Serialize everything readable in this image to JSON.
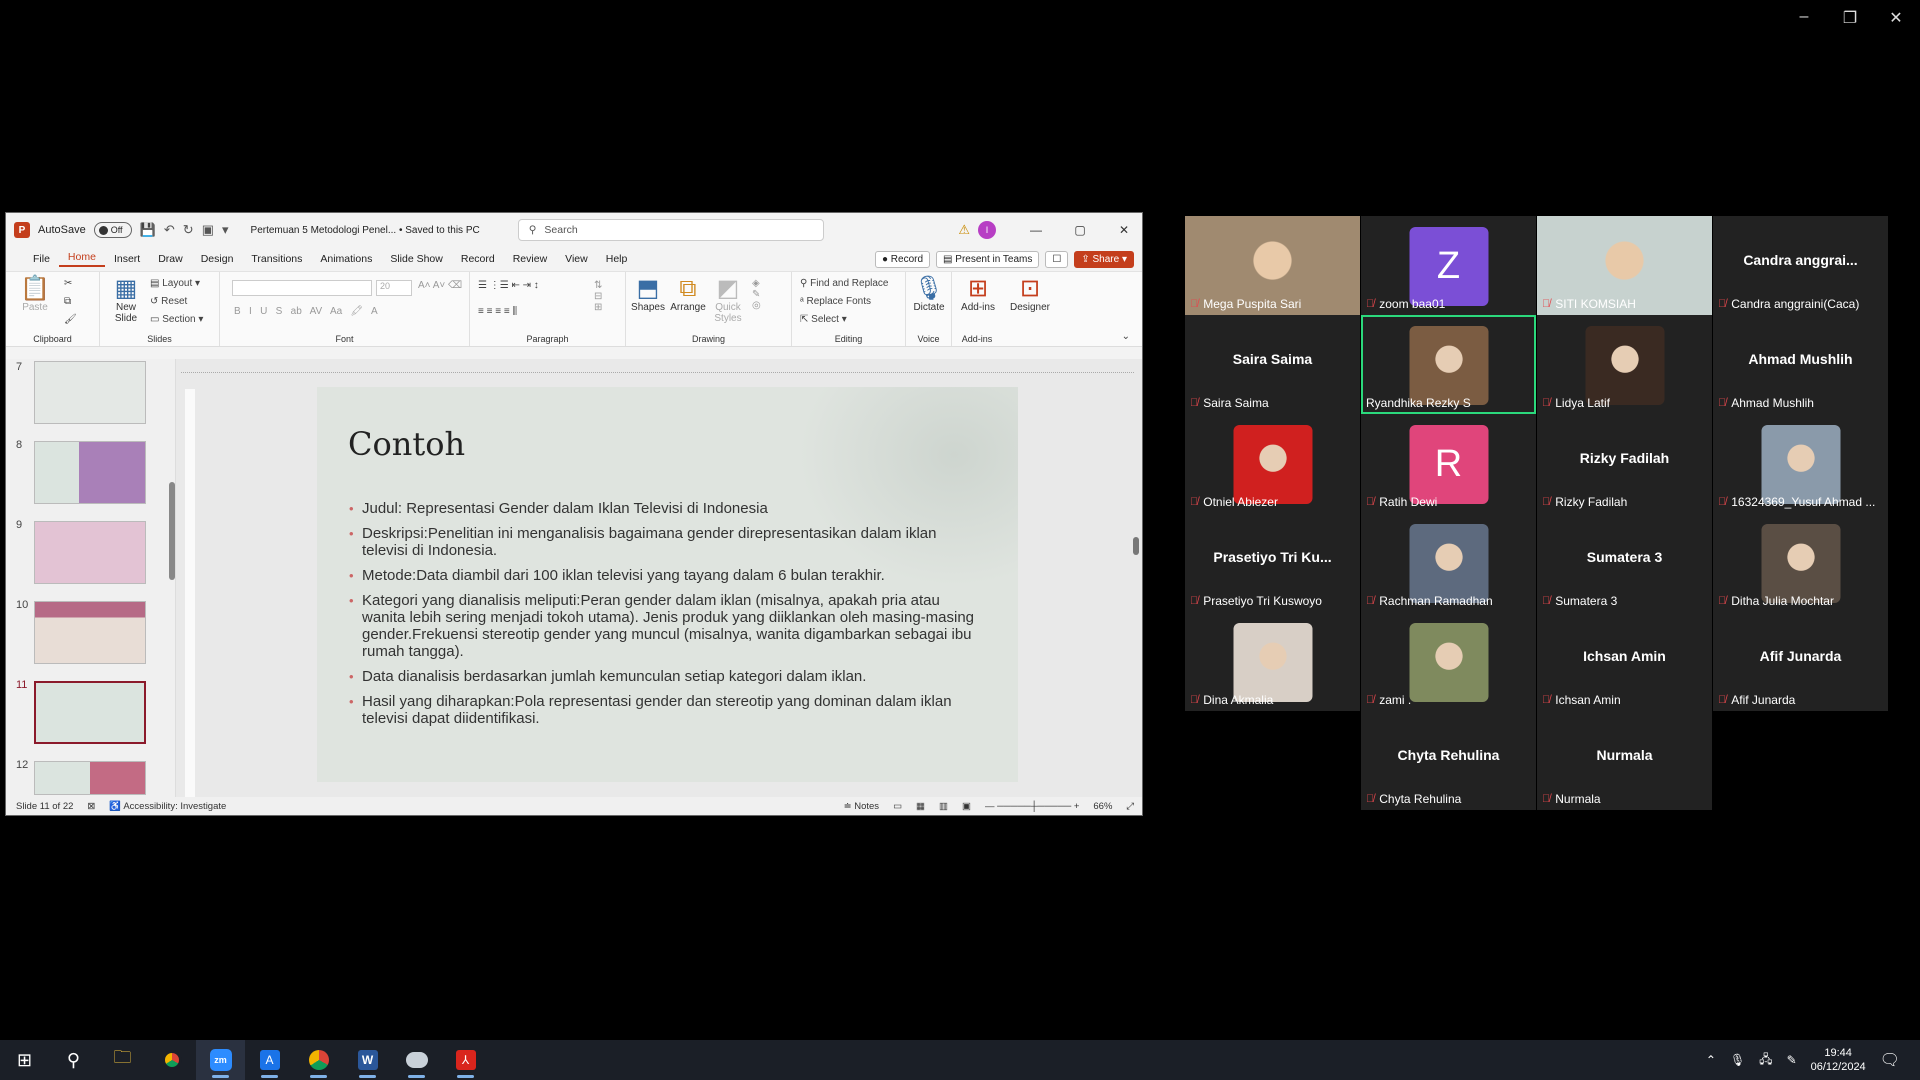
{
  "window_controls": {
    "minimize": "–",
    "restore": "❐",
    "close": "✕"
  },
  "ppt": {
    "autosave_label": "AutoSave",
    "autosave_state": "Off",
    "document_title": "Pertemuan 5 Metodologi Penel... • Saved to this PC",
    "search_placeholder": "Search",
    "user_initial": "I",
    "menu": [
      "File",
      "Home",
      "Insert",
      "Draw",
      "Design",
      "Transitions",
      "Animations",
      "Slide Show",
      "Record",
      "Review",
      "View",
      "Help"
    ],
    "record_button": "Record",
    "present_button": "Present in Teams",
    "share_button": "Share",
    "ribbon": {
      "clipboard": {
        "label": "Clipboard",
        "paste": "Paste"
      },
      "slides": {
        "label": "Slides",
        "new_slide": "New Slide",
        "layout": "Layout",
        "reset": "Reset",
        "section": "Section"
      },
      "font": {
        "label": "Font",
        "size": "20"
      },
      "paragraph": {
        "label": "Paragraph"
      },
      "drawing": {
        "label": "Drawing",
        "shapes": "Shapes",
        "arrange": "Arrange",
        "quick_styles": "Quick Styles"
      },
      "editing": {
        "label": "Editing",
        "find_replace": "Find and Replace",
        "replace_fonts": "Replace Fonts",
        "select": "Select"
      },
      "voice": {
        "label": "Voice",
        "dictate": "Dictate"
      },
      "addins": {
        "label": "Add-ins",
        "addins": "Add-ins",
        "designer": "Designer"
      }
    },
    "thumb_numbers": [
      "7",
      "8",
      "9",
      "10",
      "11",
      "12"
    ],
    "slide": {
      "title": "Contoh",
      "bullets": [
        "Judul: Representasi Gender dalam Iklan Televisi di Indonesia",
        "Deskripsi:Penelitian ini menganalisis bagaimana gender direpresentasikan dalam iklan televisi di Indonesia.",
        "Metode:Data diambil dari 100 iklan televisi yang tayang dalam 6 bulan terakhir.",
        "Kategori yang dianalisis meliputi:Peran gender dalam iklan (misalnya, apakah pria atau wanita lebih sering menjadi tokoh utama). Jenis produk yang diiklankan oleh masing-masing gender.Frekuensi stereotip gender yang muncul (misalnya, wanita digambarkan sebagai ibu rumah tangga).",
        "Data dianalisis berdasarkan jumlah kemunculan setiap kategori dalam iklan.",
        "Hasil yang diharapkan:Pola representasi gender dan stereotip yang dominan dalam iklan televisi dapat diidentifikasi."
      ]
    },
    "status": {
      "slide_count": "Slide 11 of 22",
      "accessibility": "Accessibility: Investigate",
      "notes": "Notes",
      "zoom": "66%"
    }
  },
  "participants": [
    {
      "label": "Mega Puspita Sari",
      "type": "photo",
      "color": "#a08a70"
    },
    {
      "label": "zoom baa01",
      "type": "letter",
      "letter": "Z",
      "color": "#7b4fd6"
    },
    {
      "label": "SITI KOMSIAH",
      "type": "photo",
      "color": "#c7d2cf"
    },
    {
      "label": "Candra anggraini(Caca)",
      "type": "name",
      "name": "Candra  anggrai..."
    },
    {
      "label": "Saira Saima",
      "type": "name",
      "name": "Saira Saima"
    },
    {
      "label": "Ryandhika Rezky S",
      "type": "avatar",
      "color": "#7b5c42",
      "speaking": true
    },
    {
      "label": "Lidya Latif",
      "type": "avatar",
      "color": "#3a2a22"
    },
    {
      "label": "Ahmad Mushlih",
      "type": "name",
      "name": "Ahmad Mushlih"
    },
    {
      "label": "Otniel Abiezer",
      "type": "avatar",
      "color": "#d0201f"
    },
    {
      "label": "Ratih Dewi",
      "type": "letter",
      "letter": "R",
      "color": "#e0457b"
    },
    {
      "label": "Rizky Fadilah",
      "type": "name",
      "name": "Rizky Fadilah"
    },
    {
      "label": "16324369_Yusuf Ahmad ...",
      "type": "avatar",
      "color": "#8a9aaa"
    },
    {
      "label": "Prasetiyo Tri Kuswoyo",
      "type": "name",
      "name": "Prasetiyo  Tri Ku..."
    },
    {
      "label": "Rachman Ramadhan",
      "type": "avatar",
      "color": "#5d6a7e"
    },
    {
      "label": "Sumatera 3",
      "type": "name",
      "name": "Sumatera 3"
    },
    {
      "label": "Ditha Julia Mochtar",
      "type": "avatar",
      "color": "#5a4e44"
    },
    {
      "label": "Dina Akmalia",
      "type": "avatar",
      "color": "#d8cfc6"
    },
    {
      "label": "zami .",
      "type": "avatar",
      "color": "#7f8a5e"
    },
    {
      "label": "Ichsan Amin",
      "type": "name",
      "name": "Ichsan Amin"
    },
    {
      "label": "Afif Junarda",
      "type": "name",
      "name": "Afif Junarda"
    },
    {
      "label": "Chyta Rehulina",
      "type": "name",
      "name": "Chyta Rehulina"
    },
    {
      "label": "Nurmala",
      "type": "name",
      "name": "Nurmala"
    }
  ],
  "taskbar": {
    "icons": [
      "windows-start",
      "search",
      "file-explorer",
      "chrome",
      "zoom",
      "app",
      "chrome-profile",
      "word",
      "app-2",
      "acrobat"
    ],
    "time": "19:44",
    "date": "06/12/2024"
  }
}
